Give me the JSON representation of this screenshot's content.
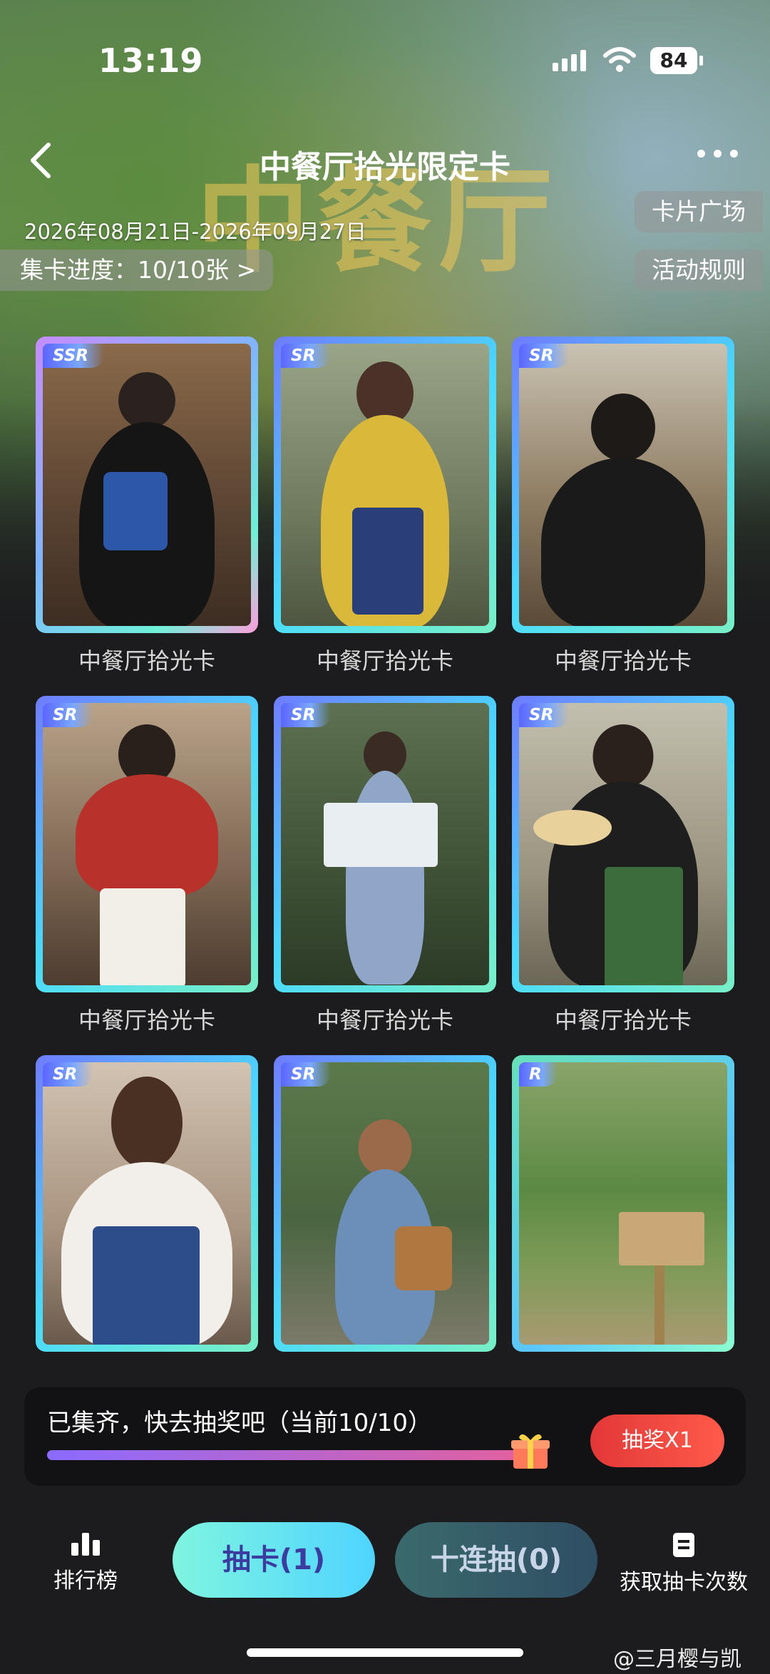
{
  "status_bar": {
    "time": "13:19",
    "battery": "84"
  },
  "header": {
    "title": "中餐厅拾光限定卡",
    "date_range": "2026年08月21日-2026年09月27日"
  },
  "progress": {
    "label": "集卡进度：10/10张 >"
  },
  "side_buttons": {
    "card_square": "卡片广场",
    "rules": "活动规则"
  },
  "cards": [
    {
      "rarity": "SSR",
      "label": "中餐厅拾光卡"
    },
    {
      "rarity": "SR",
      "label": "中餐厅拾光卡"
    },
    {
      "rarity": "SR",
      "label": "中餐厅拾光卡"
    },
    {
      "rarity": "SR",
      "label": "中餐厅拾光卡"
    },
    {
      "rarity": "SR",
      "label": "中餐厅拾光卡"
    },
    {
      "rarity": "SR",
      "label": "中餐厅拾光卡"
    },
    {
      "rarity": "SR",
      "label": ""
    },
    {
      "rarity": "SR",
      "label": ""
    },
    {
      "rarity": "R",
      "label": ""
    }
  ],
  "draw_panel": {
    "text": "已集齐，快去抽奖吧（当前10/10）",
    "progress": 1.0,
    "button": "抽奖X1"
  },
  "bottom_bar": {
    "rank": "排行榜",
    "draw_one": "抽卡(1)",
    "draw_ten": "十连抽(0)",
    "get_chances": "获取抽卡次数"
  },
  "watermark": "@三月樱与凯",
  "colors": {
    "accent_red": "#e23838",
    "cyan": "#4fd4ff",
    "background": "#1c1c1e"
  }
}
